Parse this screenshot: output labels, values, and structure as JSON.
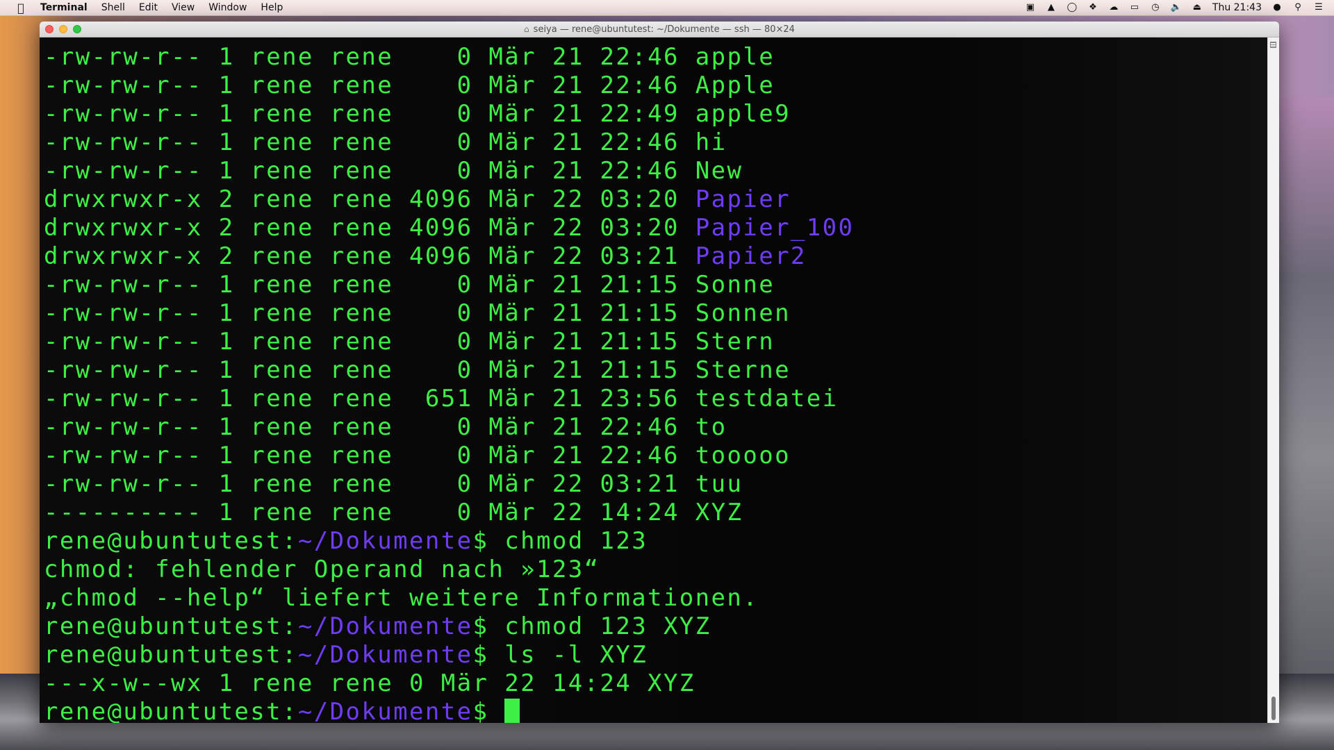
{
  "menubar": {
    "app_name": "Terminal",
    "items": [
      "Shell",
      "Edit",
      "View",
      "Window",
      "Help"
    ],
    "clock": "Thu 21:43",
    "status_icons": [
      "camera-icon",
      "drive-icon",
      "onepassword-icon",
      "dropbox-icon",
      "cloud-icon",
      "display-icon",
      "time-machine-icon",
      "volume-icon",
      "eject-icon",
      "user-icon",
      "spotlight-icon",
      "notification-center-icon"
    ]
  },
  "window": {
    "title": "seiya — rene@ubuntutest: ~/Dokumente — ssh — 80×24"
  },
  "terminal": {
    "colors": {
      "text": "#3ef046",
      "directory": "#6f3cf5",
      "background": "#000000"
    },
    "listing": [
      {
        "perm": "-rw-rw-r--",
        "links": "1",
        "user": "rene",
        "group": "rene",
        "size": "   0",
        "date": "Mär 21 22:46",
        "name": "apple",
        "dir": false
      },
      {
        "perm": "-rw-rw-r--",
        "links": "1",
        "user": "rene",
        "group": "rene",
        "size": "   0",
        "date": "Mär 21 22:46",
        "name": "Apple",
        "dir": false
      },
      {
        "perm": "-rw-rw-r--",
        "links": "1",
        "user": "rene",
        "group": "rene",
        "size": "   0",
        "date": "Mär 21 22:49",
        "name": "apple9",
        "dir": false
      },
      {
        "perm": "-rw-rw-r--",
        "links": "1",
        "user": "rene",
        "group": "rene",
        "size": "   0",
        "date": "Mär 21 22:46",
        "name": "hi",
        "dir": false
      },
      {
        "perm": "-rw-rw-r--",
        "links": "1",
        "user": "rene",
        "group": "rene",
        "size": "   0",
        "date": "Mär 21 22:46",
        "name": "New",
        "dir": false
      },
      {
        "perm": "drwxrwxr-x",
        "links": "2",
        "user": "rene",
        "group": "rene",
        "size": "4096",
        "date": "Mär 22 03:20",
        "name": "Papier",
        "dir": true
      },
      {
        "perm": "drwxrwxr-x",
        "links": "2",
        "user": "rene",
        "group": "rene",
        "size": "4096",
        "date": "Mär 22 03:20",
        "name": "Papier_100",
        "dir": true
      },
      {
        "perm": "drwxrwxr-x",
        "links": "2",
        "user": "rene",
        "group": "rene",
        "size": "4096",
        "date": "Mär 22 03:21",
        "name": "Papier2",
        "dir": true
      },
      {
        "perm": "-rw-rw-r--",
        "links": "1",
        "user": "rene",
        "group": "rene",
        "size": "   0",
        "date": "Mär 21 21:15",
        "name": "Sonne",
        "dir": false
      },
      {
        "perm": "-rw-rw-r--",
        "links": "1",
        "user": "rene",
        "group": "rene",
        "size": "   0",
        "date": "Mär 21 21:15",
        "name": "Sonnen",
        "dir": false
      },
      {
        "perm": "-rw-rw-r--",
        "links": "1",
        "user": "rene",
        "group": "rene",
        "size": "   0",
        "date": "Mär 21 21:15",
        "name": "Stern",
        "dir": false
      },
      {
        "perm": "-rw-rw-r--",
        "links": "1",
        "user": "rene",
        "group": "rene",
        "size": "   0",
        "date": "Mär 21 21:15",
        "name": "Sterne",
        "dir": false
      },
      {
        "perm": "-rw-rw-r--",
        "links": "1",
        "user": "rene",
        "group": "rene",
        "size": " 651",
        "date": "Mär 21 23:56",
        "name": "testdatei",
        "dir": false
      },
      {
        "perm": "-rw-rw-r--",
        "links": "1",
        "user": "rene",
        "group": "rene",
        "size": "   0",
        "date": "Mär 21 22:46",
        "name": "to",
        "dir": false
      },
      {
        "perm": "-rw-rw-r--",
        "links": "1",
        "user": "rene",
        "group": "rene",
        "size": "   0",
        "date": "Mär 21 22:46",
        "name": "tooooo",
        "dir": false
      },
      {
        "perm": "-rw-rw-r--",
        "links": "1",
        "user": "rene",
        "group": "rene",
        "size": "   0",
        "date": "Mär 22 03:21",
        "name": "tuu",
        "dir": false
      },
      {
        "perm": "----------",
        "links": "1",
        "user": "rene",
        "group": "rene",
        "size": "   0",
        "date": "Mär 22 14:24",
        "name": "XYZ",
        "dir": false
      }
    ],
    "prompt_user_host": "rene@ubuntutest",
    "prompt_path": "~/Dokumente",
    "prompt_sign": "$",
    "session": [
      {
        "type": "prompt",
        "command": " chmod 123"
      },
      {
        "type": "output",
        "text": "chmod: fehlender Operand nach »123“"
      },
      {
        "type": "output",
        "text": "„chmod --help“ liefert weitere Informationen."
      },
      {
        "type": "prompt",
        "command": " chmod 123 XYZ"
      },
      {
        "type": "prompt",
        "command": " ls -l XYZ"
      },
      {
        "type": "output",
        "text": "---x-w--wx 1 rene rene 0 Mär 22 14:24 XYZ"
      },
      {
        "type": "prompt",
        "command": " ",
        "cursor": true
      }
    ]
  }
}
